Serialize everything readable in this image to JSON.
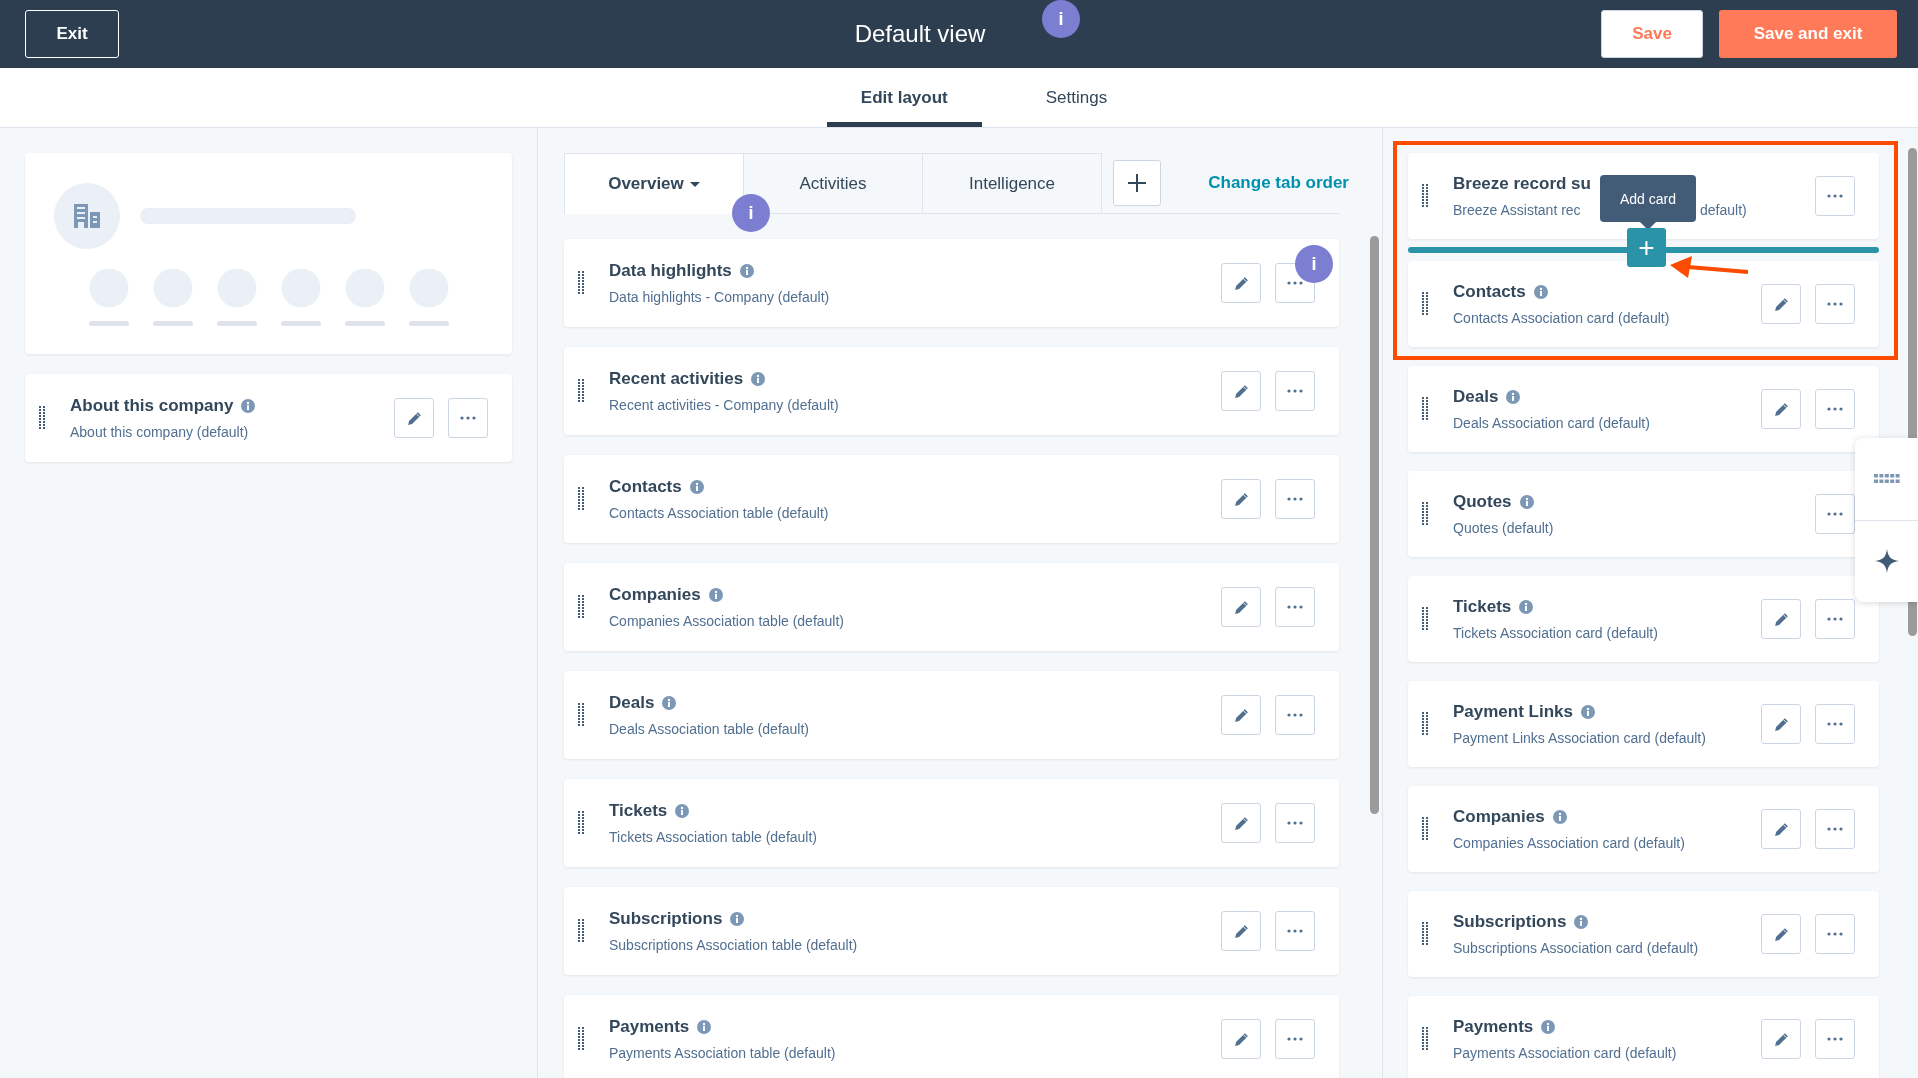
{
  "header": {
    "exit": "Exit",
    "title": "Default view",
    "hint_badge": "i",
    "save": "Save",
    "save_and_exit": "Save and exit"
  },
  "view_tabs": [
    {
      "label": "Edit layout",
      "selected": true
    },
    {
      "label": "Settings",
      "selected": false
    }
  ],
  "left_column": {
    "cards": [
      {
        "title": "About this company",
        "subtitle": "About this company (default)",
        "editable": true
      }
    ]
  },
  "middle_column": {
    "tabs": [
      {
        "label": "Overview",
        "selected": true,
        "dropdown": true
      },
      {
        "label": "Activities",
        "selected": false,
        "dropdown": false
      },
      {
        "label": "Intelligence",
        "selected": false,
        "dropdown": false
      }
    ],
    "tab_hint_badge": "i",
    "change_tab_order": "Change tab order",
    "cards": [
      {
        "title": "Data highlights",
        "subtitle": "Data highlights - Company (default)",
        "editable": true,
        "hint_badge": "i"
      },
      {
        "title": "Recent activities",
        "subtitle": "Recent activities - Company (default)",
        "editable": true
      },
      {
        "title": "Contacts",
        "subtitle": "Contacts Association table (default)",
        "editable": true
      },
      {
        "title": "Companies",
        "subtitle": "Companies Association table (default)",
        "editable": true
      },
      {
        "title": "Deals",
        "subtitle": "Deals Association table (default)",
        "editable": true
      },
      {
        "title": "Tickets",
        "subtitle": "Tickets Association table (default)",
        "editable": true
      },
      {
        "title": "Subscriptions",
        "subtitle": "Subscriptions Association table (default)",
        "editable": true
      },
      {
        "title": "Payments",
        "subtitle": "Payments Association table (default)",
        "editable": true
      }
    ]
  },
  "right_column": {
    "tooltip": "Add card",
    "add_button": "+",
    "breeze_card": {
      "title": "Breeze record su",
      "subtitle_start": "Breeze Assistant rec",
      "subtitle_end": "default)"
    },
    "cards": [
      {
        "title": "Contacts",
        "subtitle": "Contacts Association card (default)",
        "editable": true
      },
      {
        "title": "Deals",
        "subtitle": "Deals Association card (default)",
        "editable": true
      },
      {
        "title": "Quotes",
        "subtitle": "Quotes (default)",
        "editable": false
      },
      {
        "title": "Tickets",
        "subtitle": "Tickets Association card (default)",
        "editable": true
      },
      {
        "title": "Payment Links",
        "subtitle": "Payment Links Association card (default)",
        "editable": true
      },
      {
        "title": "Companies",
        "subtitle": "Companies Association card (default)",
        "editable": true
      },
      {
        "title": "Subscriptions",
        "subtitle": "Subscriptions Association card (default)",
        "editable": true
      },
      {
        "title": "Payments",
        "subtitle": "Payments Association card (default)",
        "editable": true
      }
    ]
  }
}
